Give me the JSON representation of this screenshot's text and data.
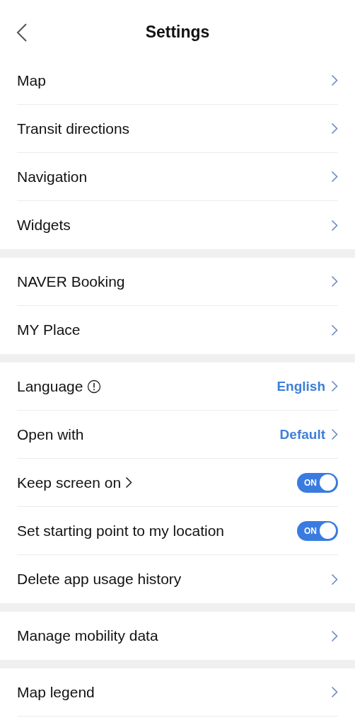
{
  "header": {
    "title": "Settings"
  },
  "groups": [
    {
      "rows": [
        {
          "kind": "link",
          "label": "Map"
        },
        {
          "kind": "link",
          "label": "Transit directions"
        },
        {
          "kind": "link",
          "label": "Navigation"
        },
        {
          "kind": "link",
          "label": "Widgets"
        }
      ]
    },
    {
      "rows": [
        {
          "kind": "link",
          "label": "NAVER Booking"
        },
        {
          "kind": "link",
          "label": "MY Place"
        }
      ]
    },
    {
      "rows": [
        {
          "kind": "value",
          "label": "Language",
          "info": true,
          "value": "English"
        },
        {
          "kind": "value",
          "label": "Open with",
          "value": "Default"
        },
        {
          "kind": "toggle",
          "label": "Keep screen on",
          "inline_chevron": true,
          "on": true,
          "toggle_text": "ON"
        },
        {
          "kind": "toggle",
          "label": "Set starting point to my location",
          "on": true,
          "toggle_text": "ON"
        },
        {
          "kind": "link",
          "label": "Delete app usage history"
        }
      ]
    },
    {
      "rows": [
        {
          "kind": "link",
          "label": "Manage mobility data"
        }
      ]
    },
    {
      "rows": [
        {
          "kind": "link",
          "label": "Map legend"
        }
      ]
    }
  ]
}
